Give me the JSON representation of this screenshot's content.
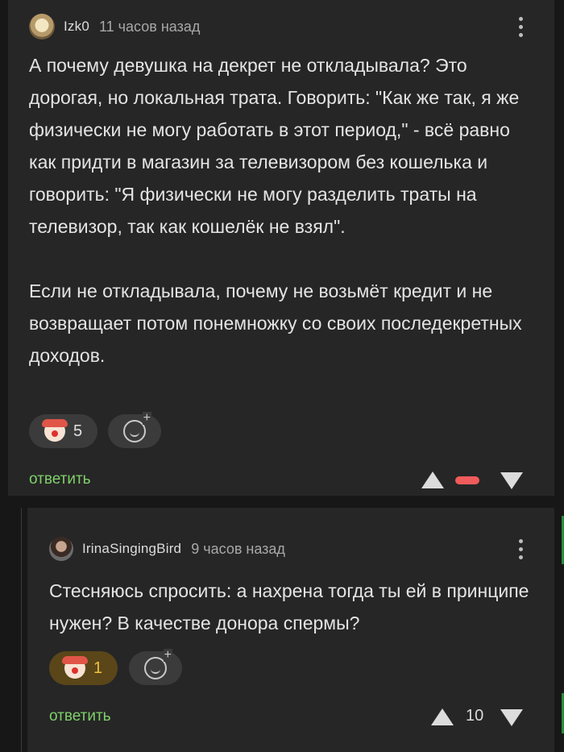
{
  "comments": [
    {
      "username": "Izk0",
      "time": "11 часов назад",
      "paragraphs": [
        "А почему девушка на декрет не откладывала? Это дорогая, но локальная трата. Говорить: \"Как же так, я же физически не могу работать в этот период,\" - всё равно как придти в магазин за телевизором без кошелька и говорить: \"Я физически не могу разделить траты на телевизор, так как кошелёк не взял\".",
        "Если не откладывала, почему не возьмёт кредит и не возвращает потом понемножку со своих последекретных доходов."
      ],
      "reaction": {
        "icon": "clown-emoji-icon",
        "count": "5"
      },
      "reply_label": "ответить",
      "rating": ""
    },
    {
      "username": "IrinaSingingBird",
      "time": "9 часов назад",
      "paragraphs": [
        "Стесняюсь спросить: а нахрена тогда ты ей в принципе нужен? В качестве донора спермы?"
      ],
      "reaction": {
        "icon": "clown-emoji-icon",
        "count": "1"
      },
      "reply_label": "ответить",
      "rating": "10"
    }
  ],
  "colors": {
    "background": "#171717",
    "card": "#262626",
    "reply_link": "#7fd06a",
    "minus_indicator": "#f05b5b",
    "active_reaction": "#5a4619"
  }
}
